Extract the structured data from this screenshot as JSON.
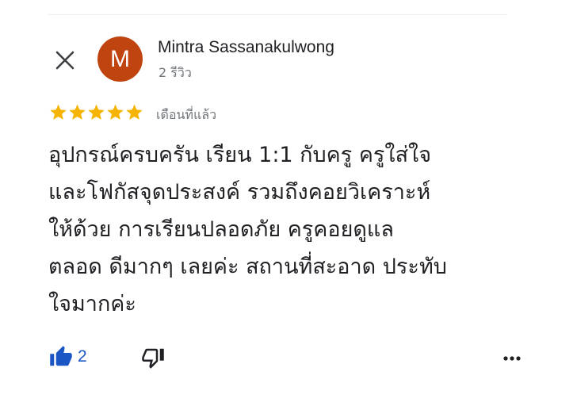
{
  "reviewer": {
    "avatar_initial": "M",
    "avatar_color": "#c0440f",
    "name": "Mintra Sassanakulwong",
    "review_count": "2 รีวิว"
  },
  "rating": {
    "stars": 5,
    "max": 5,
    "star_color": "#f4b400",
    "time": "เดือนที่แล้ว"
  },
  "review": {
    "lines": [
      "อุปกรณ์ครบครัน เรียน 1:1 กับครู ครูใส่ใจ",
      "และโฟกัสจุดประสงค์ รวมถึงคอยวิเคราะห์",
      "ให้ด้วย การเรียนปลอดภัย ครูคอยดูแล",
      "ตลอด ดีมากๆ เลยค่ะ สถานที่สะอาด ประทับ",
      "ใจมากค่ะ"
    ]
  },
  "actions": {
    "like_count": "2",
    "like_color": "#1a56c4",
    "icons": [
      "close-icon",
      "thumbs-up-icon",
      "thumbs-down-icon",
      "more-icon"
    ]
  }
}
